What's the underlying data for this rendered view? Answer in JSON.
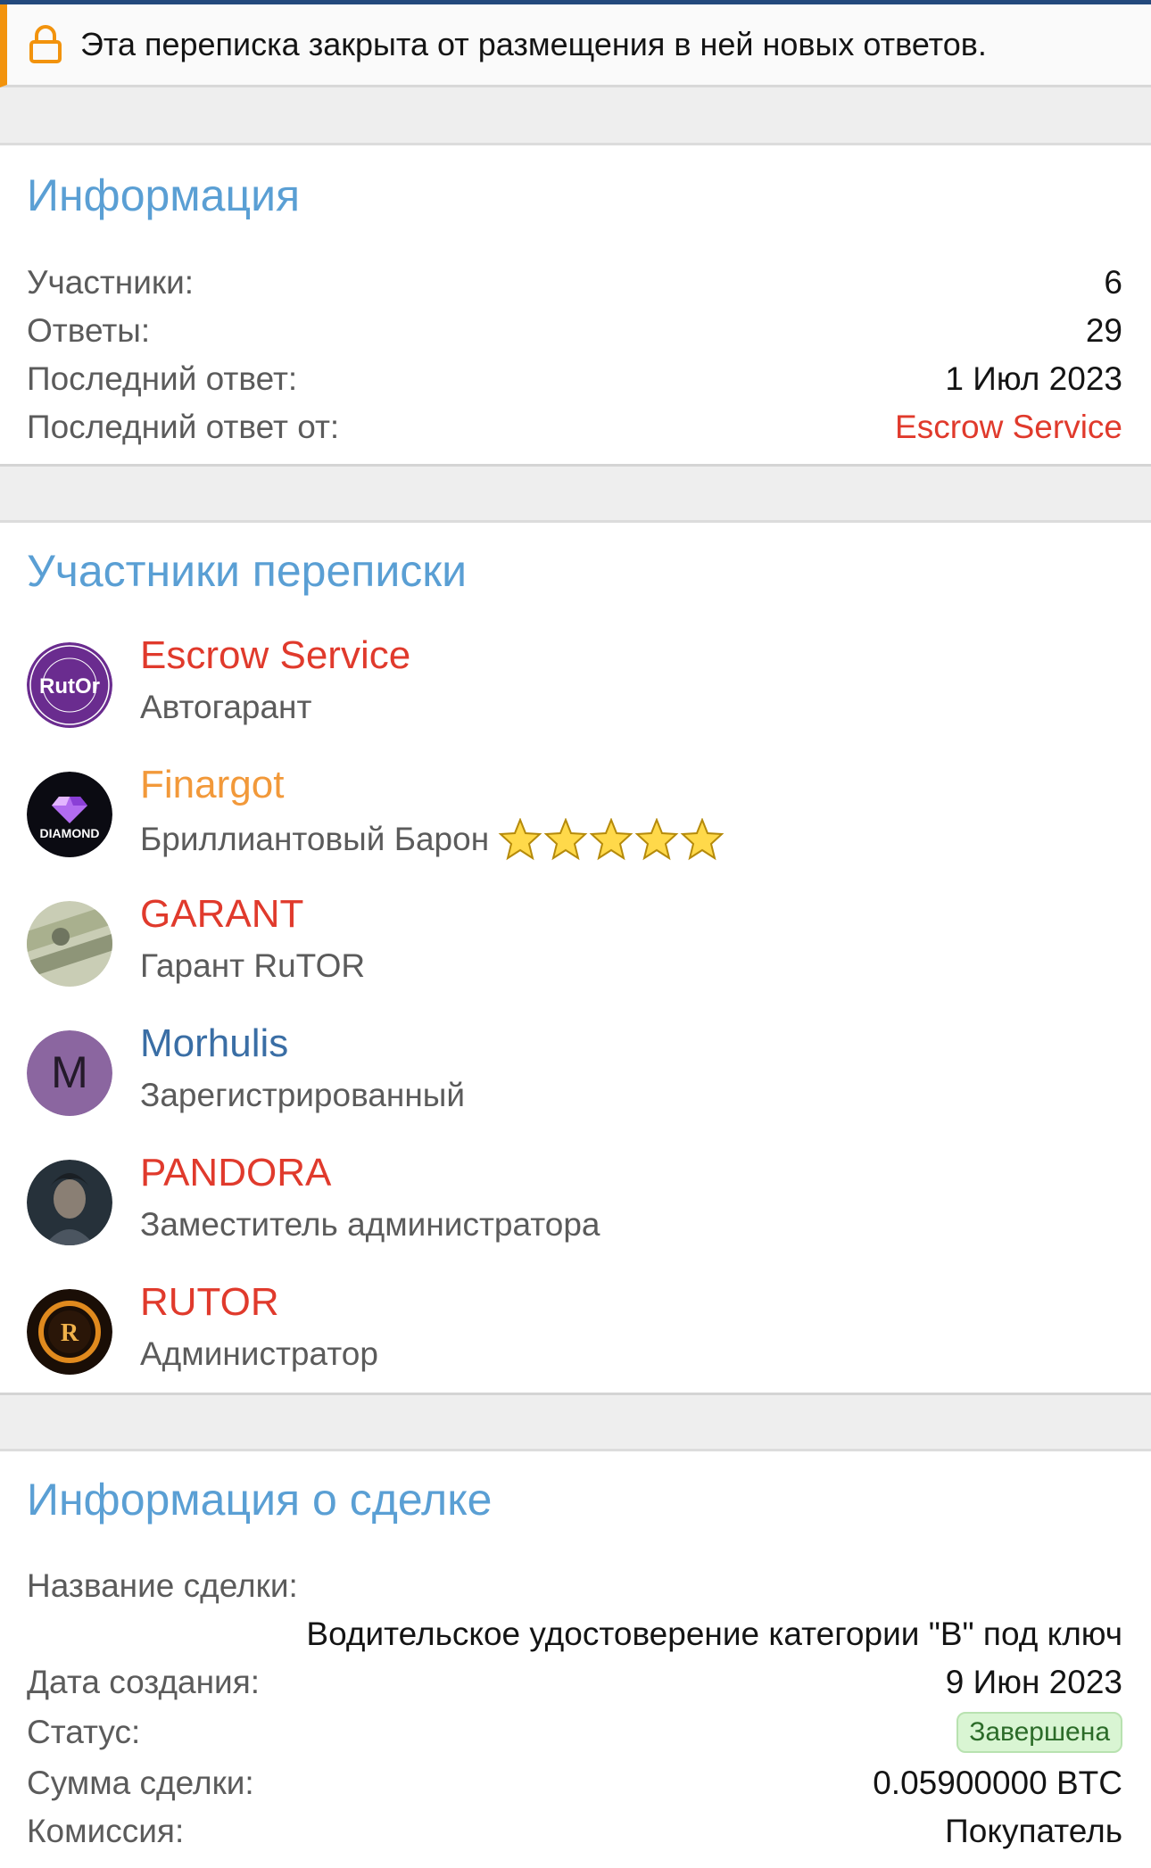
{
  "notice": {
    "text": "Эта переписка закрыта от размещения в ней новых ответов.",
    "icon": "lock-icon",
    "accent": "#f2930d"
  },
  "info": {
    "title": "Информация",
    "participants_label": "Участники:",
    "participants_value": "6",
    "replies_label": "Ответы:",
    "replies_value": "29",
    "last_reply_label": "Последний ответ:",
    "last_reply_value": "1 Июл 2023",
    "last_reply_by_label": "Последний ответ от:",
    "last_reply_by_value": "Escrow Service"
  },
  "members": {
    "title": "Участники переписки",
    "items": [
      {
        "name": "Escrow Service",
        "role": "Автогарант",
        "color": "#e03a2c",
        "avatar": "RutOr"
      },
      {
        "name": "Finargot",
        "role": "Бриллиантовый Барон",
        "color": "#f2993a",
        "avatar": "DIAMOND",
        "stars": 5
      },
      {
        "name": "GARANT",
        "role": "Гарант RuTOR",
        "color": "#e03a2c"
      },
      {
        "name": "Morhulis",
        "role": "Зарегистрированный",
        "color": "#3a6ea5",
        "avatar": "M"
      },
      {
        "name": "PANDORA",
        "role": "Заместитель администратора",
        "color": "#e03a2c"
      },
      {
        "name": "RUTOR",
        "role": "Администратор",
        "color": "#e03a2c",
        "avatar": "R"
      }
    ]
  },
  "deal": {
    "title": "Информация о сделке",
    "name_label": "Название сделки:",
    "name_value": "Водительское удостоверение категории \"B\" под ключ",
    "created_label": "Дата создания:",
    "created_value": "9 Июн 2023",
    "status_label": "Статус:",
    "status_value": "Завершена",
    "amount_label": "Сумма сделки:",
    "amount_value": "0.05900000 BTC",
    "fee_label": "Комиссия:",
    "fee_value": "Покупатель"
  }
}
